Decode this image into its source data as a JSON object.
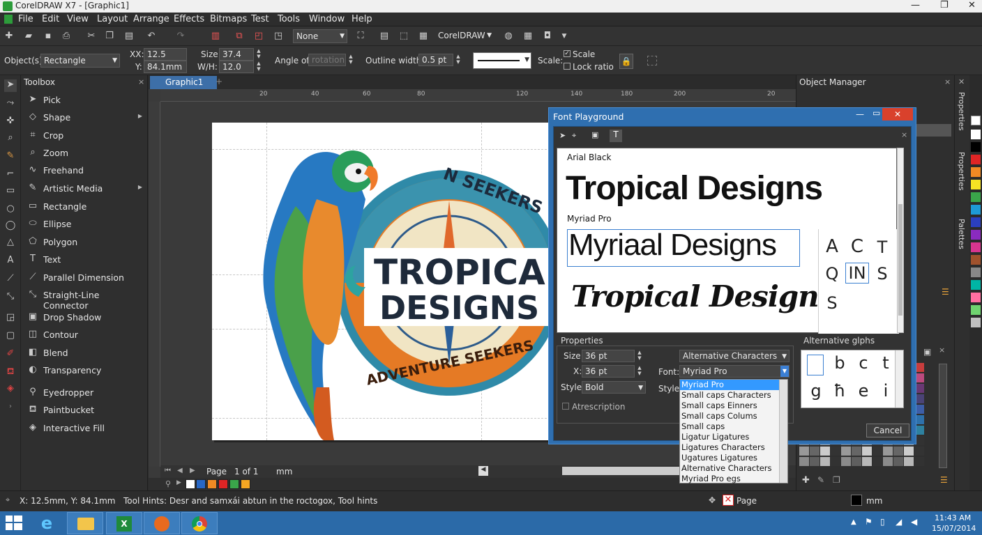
{
  "window": {
    "title": "CorelDRAW X7 - [Graphic1]",
    "minimize": "—",
    "maximize": "❐",
    "close": "✕"
  },
  "menu": [
    "File",
    "Edit",
    "View",
    "Layout",
    "Arrange",
    "Effects",
    "Bitmaps",
    "Test",
    "Tools",
    "Window",
    "Help"
  ],
  "toolbar": {
    "snap_value": "None",
    "launcher": "CorelDRAW"
  },
  "propbar": {
    "objects_label": "Object(s):",
    "objects_value": "Rectangle",
    "x_label": "XX:",
    "x_value": "12.5 mm",
    "y_label": "Y:",
    "y_value": "84.1mm",
    "size_label": "Size:",
    "size_value": "37.4",
    "wh_label": "W/H:",
    "wh_value": "12.0",
    "angle_label": "Angle of",
    "angle_placeholder": "rotation",
    "outline_label": "Outline width:",
    "outline_value": "0.5 pt",
    "scale_label": "Scale:",
    "scale_check": "Scale",
    "lock_ratio": "Lock ratio"
  },
  "toolbox": {
    "title": "Toolbox",
    "items": [
      {
        "label": "Pick",
        "icon": "pick-arrow-icon",
        "glyph": "➤",
        "arrow": ""
      },
      {
        "label": "Shape",
        "icon": "shape-icon",
        "glyph": "◇",
        "arrow": "▶"
      },
      {
        "label": "Crop",
        "icon": "crop-icon",
        "glyph": "⌗",
        "arrow": ""
      },
      {
        "label": "Zoom",
        "icon": "zoom-icon",
        "glyph": "⌕",
        "arrow": ""
      },
      {
        "label": "Freehand",
        "icon": "freehand-icon",
        "glyph": "∿",
        "arrow": ""
      },
      {
        "label": "Artistic Media",
        "icon": "artistic-media-icon",
        "glyph": "✎",
        "arrow": "▶"
      },
      {
        "label": "Rectangle",
        "icon": "rectangle-icon",
        "glyph": "▭",
        "arrow": ""
      },
      {
        "label": "Ellipse",
        "icon": "ellipse-icon",
        "glyph": "⬭",
        "arrow": ""
      },
      {
        "label": "Polygon",
        "icon": "polygon-icon",
        "glyph": "⬠",
        "arrow": ""
      },
      {
        "label": "Text",
        "icon": "text-icon",
        "glyph": "T",
        "arrow": ""
      },
      {
        "label": "Parallel Dimension",
        "icon": "parallel-dimension-icon",
        "glyph": "⟋",
        "arrow": ""
      },
      {
        "label": "Straight-Line Connector",
        "icon": "connector-icon",
        "glyph": "⤡",
        "arrow": ""
      },
      {
        "label": "Drop Shadow",
        "icon": "drop-shadow-icon",
        "glyph": "▣",
        "arrow": ""
      },
      {
        "label": "Contour",
        "icon": "contour-icon",
        "glyph": "◫",
        "arrow": ""
      },
      {
        "label": "Blend",
        "icon": "blend-icon",
        "glyph": "◧",
        "arrow": ""
      },
      {
        "label": "Transparency",
        "icon": "transparency-icon",
        "glyph": "◐",
        "arrow": ""
      },
      {
        "label": "Eyedropper",
        "icon": "eyedropper-icon",
        "glyph": "⚲",
        "arrow": ""
      },
      {
        "label": "Paintbucket",
        "icon": "paintbucket-icon",
        "glyph": "⛾",
        "arrow": ""
      },
      {
        "label": "Interactive Fill",
        "icon": "interactive-fill-icon",
        "glyph": "◈",
        "arrow": ""
      }
    ]
  },
  "document": {
    "tab": "Graphic1",
    "ruler_ticks": [
      "20",
      "40",
      "60",
      "80",
      "120",
      "140",
      "180",
      "200",
      "20"
    ],
    "page_label": "Page",
    "page_of": "1 of 1",
    "units": "mm",
    "logo": {
      "top_text": "N SEEKERS",
      "title1": "TROPICA",
      "title2": "DESIGNS",
      "bottom_text": "ADVENTURE SEEKERS"
    }
  },
  "font_dialog": {
    "title": "Font Playground",
    "sample1_font": "Arial Black",
    "sample1_text": "Tropical Designs",
    "sample2_font": "Myriad Pro",
    "sample2_text": "Myriaal Designs",
    "sample3_text": "Tropical Designs",
    "glyphs": [
      "A",
      "C",
      "T",
      "Q",
      "IN",
      "S",
      "S"
    ],
    "properties_title": "Properties",
    "size_label": "Size:",
    "size_value": "36 pt",
    "x_label": "X:",
    "x_value": "36 pt",
    "style_label": "Style:",
    "style_value": "Bold",
    "style_label2": "Style:",
    "attr_check": "Atrescription",
    "alt_chars_value": "Alternative Characters",
    "font_label": "Font:",
    "font_value": "Myriad Pro",
    "alt_glyphs_title": "Alternative glphs",
    "alt_glyphs": [
      "",
      "b",
      "c",
      "t",
      "g",
      "ħ",
      "e",
      "i"
    ],
    "cancel": "Cancel",
    "dropdown_options": [
      "Myriad Pro",
      "Small caps Characters",
      "Small caps Einners",
      "Small caps Colums",
      "Small caps",
      "Ligatur Ligatures",
      "Ligatures Characters",
      "Ugatures Ligatures",
      "Alternative Characters",
      "Myriad Pro egs"
    ]
  },
  "object_manager": {
    "title": "Object Manager"
  },
  "dock_tabs": [
    "Properties",
    "Properties",
    "Palettes"
  ],
  "status": {
    "coords": "X: 12.5mm, Y: 84.1mm",
    "hints": "Tool Hints: Desr and samxái abtun in the roctogox, Tool hints",
    "page": "Page",
    "units": "mm"
  },
  "clock": {
    "time": "11:43 AM",
    "date": "15/07/2014"
  },
  "colors": {
    "accent": "#2f6fb0",
    "taskbar": "#2b6aa8"
  }
}
